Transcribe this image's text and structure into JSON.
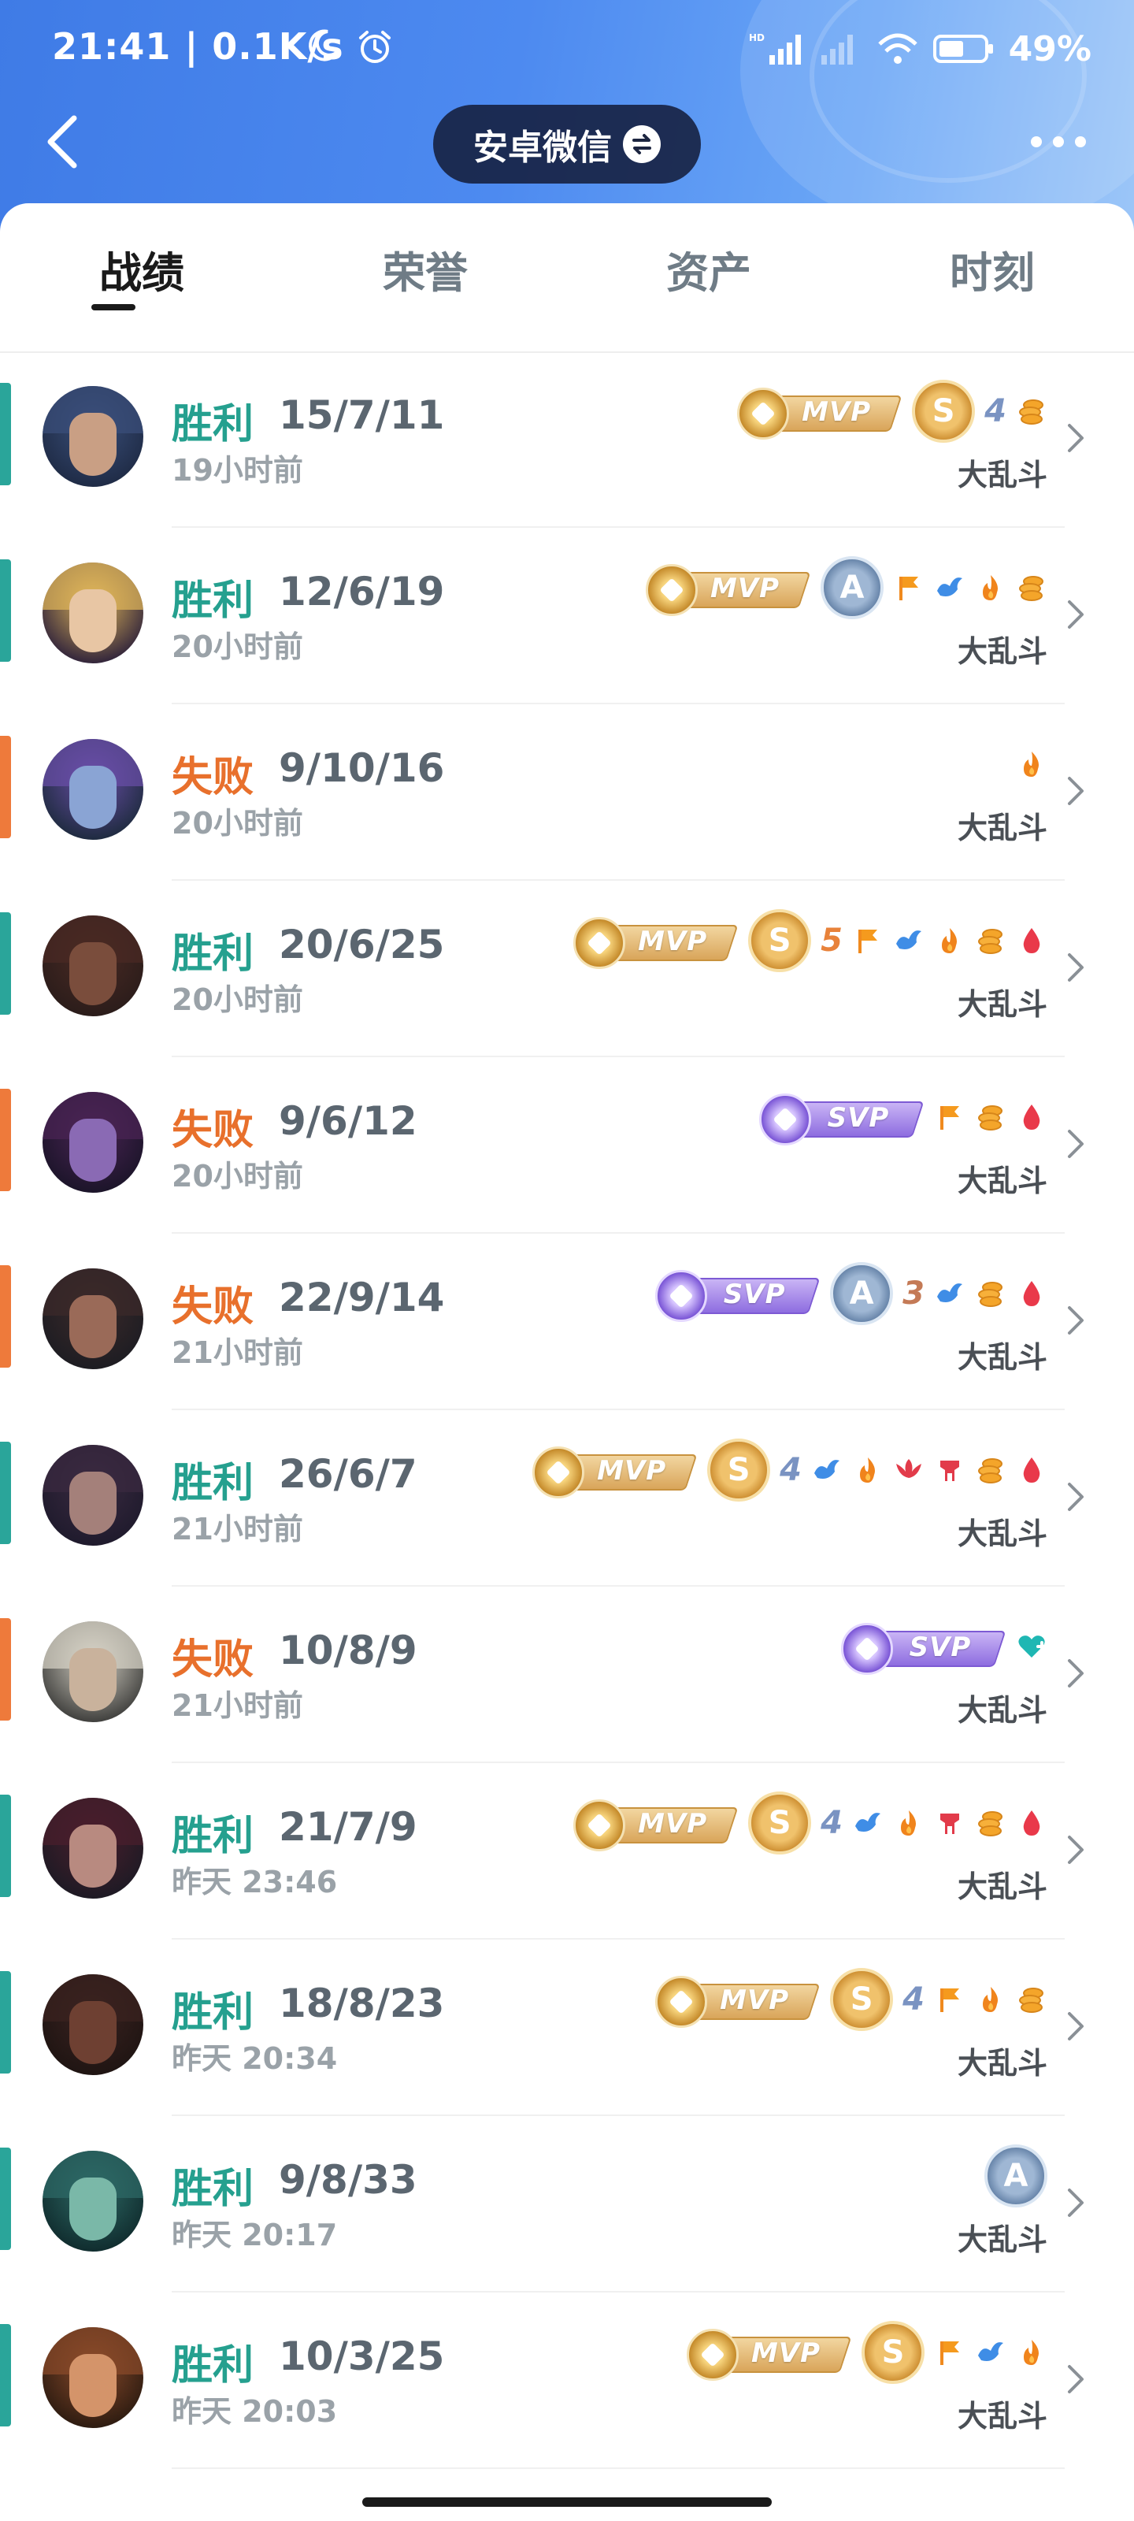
{
  "status_bar": {
    "time": "21:41 | 0.1K/s",
    "battery_text": "49%"
  },
  "nav": {
    "title": "安卓微信"
  },
  "tabs": [
    {
      "label": "战绩",
      "active": true
    },
    {
      "label": "荣誉",
      "active": false
    },
    {
      "label": "资产",
      "active": false
    },
    {
      "label": "时刻",
      "active": false
    }
  ],
  "colors": {
    "win": "#25a08f",
    "loss": "#e8702c",
    "header_blue": "#4d8af0"
  },
  "matches": [
    {
      "result": "胜利",
      "outcome": "win",
      "kda": "15/7/11",
      "time": "19小时前",
      "mode": "大乱斗",
      "badge": "MVP",
      "badge_style": "gold",
      "grade": "S",
      "multikill": "4",
      "icons": [
        "gold-coin-icon"
      ]
    },
    {
      "result": "胜利",
      "outcome": "win",
      "kda": "12/6/19",
      "time": "20小时前",
      "mode": "大乱斗",
      "badge": "MVP",
      "badge_style": "gold",
      "grade": "A",
      "multikill": "",
      "icons": [
        "flag-icon",
        "bird-icon",
        "flame-icon",
        "gold-coin-icon"
      ]
    },
    {
      "result": "失败",
      "outcome": "loss",
      "kda": "9/10/16",
      "time": "20小时前",
      "mode": "大乱斗",
      "badge": "",
      "badge_style": "",
      "grade": "",
      "multikill": "",
      "icons": [
        "flame-icon"
      ]
    },
    {
      "result": "胜利",
      "outcome": "win",
      "kda": "20/6/25",
      "time": "20小时前",
      "mode": "大乱斗",
      "badge": "MVP",
      "badge_style": "gold",
      "grade": "S",
      "multikill": "5",
      "icons": [
        "flag-icon",
        "bird-icon",
        "flame-icon",
        "gold-coin-icon",
        "blood-drop-icon"
      ]
    },
    {
      "result": "失败",
      "outcome": "loss",
      "kda": "9/6/12",
      "time": "20小时前",
      "mode": "大乱斗",
      "badge": "SVP",
      "badge_style": "purple",
      "grade": "",
      "multikill": "",
      "icons": [
        "flag-icon",
        "gold-coin-icon",
        "blood-drop-icon"
      ]
    },
    {
      "result": "失败",
      "outcome": "loss",
      "kda": "22/9/14",
      "time": "21小时前",
      "mode": "大乱斗",
      "badge": "SVP",
      "badge_style": "purple",
      "grade": "A",
      "multikill": "3",
      "icons": [
        "bird-icon",
        "gold-coin-icon",
        "blood-drop-icon"
      ]
    },
    {
      "result": "胜利",
      "outcome": "win",
      "kda": "26/6/7",
      "time": "21小时前",
      "mode": "大乱斗",
      "badge": "MVP",
      "badge_style": "gold",
      "grade": "S",
      "multikill": "4",
      "icons": [
        "bird-icon",
        "flame-icon",
        "wings-icon",
        "tower-icon",
        "gold-coin-icon",
        "blood-drop-icon"
      ]
    },
    {
      "result": "失败",
      "outcome": "loss",
      "kda": "10/8/9",
      "time": "21小时前",
      "mode": "大乱斗",
      "badge": "SVP",
      "badge_style": "purple",
      "grade": "",
      "multikill": "",
      "icons": [
        "heart-plus-icon"
      ]
    },
    {
      "result": "胜利",
      "outcome": "win",
      "kda": "21/7/9",
      "time": "昨天 23:46",
      "mode": "大乱斗",
      "badge": "MVP",
      "badge_style": "gold",
      "grade": "S",
      "multikill": "4",
      "icons": [
        "bird-icon",
        "flame-icon",
        "tower-icon",
        "gold-coin-icon",
        "blood-drop-icon"
      ]
    },
    {
      "result": "胜利",
      "outcome": "win",
      "kda": "18/8/23",
      "time": "昨天 20:34",
      "mode": "大乱斗",
      "badge": "MVP",
      "badge_style": "gold",
      "grade": "S",
      "multikill": "4",
      "icons": [
        "flag-icon",
        "flame-icon",
        "gold-coin-icon"
      ]
    },
    {
      "result": "胜利",
      "outcome": "win",
      "kda": "9/8/33",
      "time": "昨天 20:17",
      "mode": "大乱斗",
      "badge": "",
      "badge_style": "",
      "grade": "A",
      "multikill": "",
      "icons": []
    },
    {
      "result": "胜利",
      "outcome": "win",
      "kda": "10/3/25",
      "time": "昨天 20:03",
      "mode": "大乱斗",
      "badge": "MVP",
      "badge_style": "gold",
      "grade": "S",
      "multikill": "",
      "icons": [
        "flag-icon",
        "bird-icon",
        "flame-icon"
      ]
    }
  ]
}
